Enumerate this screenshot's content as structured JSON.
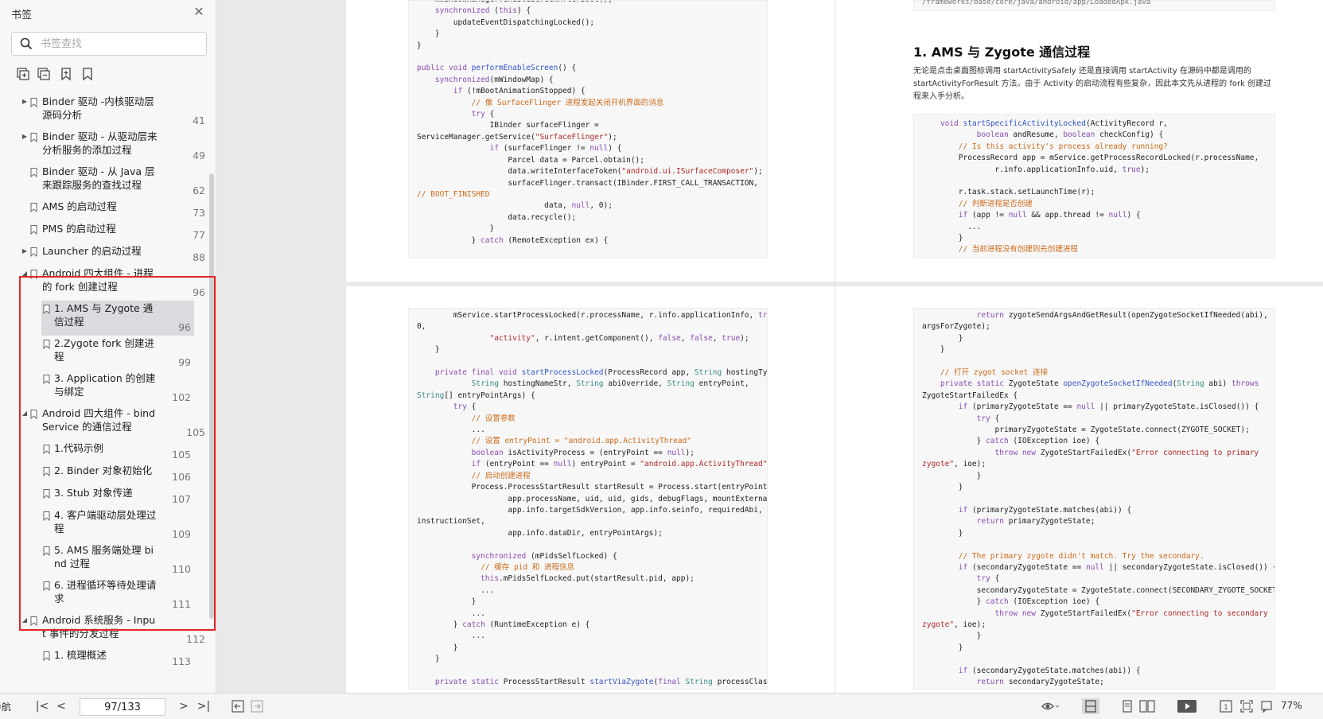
{
  "sidebar": {
    "title": "书签",
    "search_placeholder": "书签查找",
    "items": [
      {
        "label": "Binder 驱动 -内核驱动层\n源码分析",
        "page": "41",
        "arrow": "right",
        "level": 0
      },
      {
        "label": "Binder 驱动 - 从驱动层来\n分析服务的添加过程",
        "page": "49",
        "arrow": "right",
        "level": 0
      },
      {
        "label": "Binder 驱动 - 从 Java 层\n来跟踪服务的查找过程",
        "page": "62",
        "arrow": "",
        "level": 0
      },
      {
        "label": "AMS 的启动过程",
        "page": "73",
        "arrow": "",
        "level": 0
      },
      {
        "label": "PMS 的启动过程",
        "page": "77",
        "arrow": "",
        "level": 0
      },
      {
        "label": "Launcher 的启动过程",
        "page": "88",
        "arrow": "right",
        "level": 0
      },
      {
        "label": "Android 四大组件 - 进程\n的 fork 创建过程",
        "page": "96",
        "arrow": "down",
        "level": 0
      },
      {
        "label": "1. AMS 与 Zygote 通\n信过程",
        "page": "96",
        "arrow": "",
        "level": 1,
        "selected": true
      },
      {
        "label": "2.Zygote fork 创建进\n程",
        "page": "99",
        "arrow": "",
        "level": 1
      },
      {
        "label": "3. Application 的创建\n与绑定",
        "page": "102",
        "arrow": "",
        "level": 1
      },
      {
        "label": "Android 四大组件 - bind\nService 的通信过程",
        "page": "105",
        "arrow": "down",
        "level": 0
      },
      {
        "label": "1.代码示例",
        "page": "105",
        "arrow": "",
        "level": 1
      },
      {
        "label": "2. Binder 对象初始化",
        "page": "106",
        "arrow": "",
        "level": 1
      },
      {
        "label": "3. Stub 对象传递",
        "page": "107",
        "arrow": "",
        "level": 1
      },
      {
        "label": "4. 客户端驱动层处理过\n程",
        "page": "109",
        "arrow": "",
        "level": 1
      },
      {
        "label": "5. AMS 服务端处理 bi\nnd 过程",
        "page": "110",
        "arrow": "",
        "level": 1
      },
      {
        "label": "6. 进程循环等待处理请\n求",
        "page": "111",
        "arrow": "",
        "level": 1
      },
      {
        "label": "Android 系统服务 - Inpu\nt 事件的分发过程",
        "page": "112",
        "arrow": "down",
        "level": 0
      },
      {
        "label": "1. 梳理概述",
        "page": "113",
        "arrow": "",
        "level": 1
      }
    ]
  },
  "document": {
    "path_text": "/frameworks/base/core/java/android/app/LoadedApk.java",
    "section_title": "1. AMS 与 Zygote 通信过程",
    "section_para": "无论是点击桌面图标调用 startActivitySafely 还是直接调用 startActivity 在源码中都是调用的 startActivityForResult 方法。由于 Activity 的启动流程有些复杂，因此本文先从进程的 fork 创建过程来入手分析。"
  },
  "bottombar": {
    "nav_label": "导航",
    "page_indicator": "97/133",
    "zoom": "77%"
  },
  "colors": {
    "highlight_box": "#e32626",
    "selected_bg": "#d9dbde",
    "keyword": "#8a4bb5",
    "function": "#3355cc",
    "string": "#b02828",
    "comment": "#cc6b1a"
  }
}
